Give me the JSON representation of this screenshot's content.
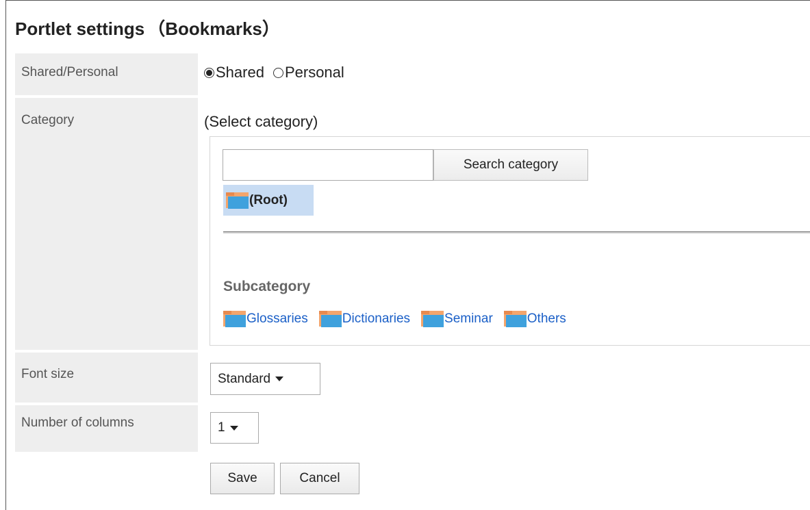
{
  "page": {
    "title": "Portlet settings",
    "title_suffix": "（Bookmarks）"
  },
  "shared_personal": {
    "label": "Shared/Personal",
    "options": [
      {
        "label": "Shared",
        "checked": true
      },
      {
        "label": "Personal",
        "checked": false
      }
    ]
  },
  "category": {
    "label": "Category",
    "selected_text": "(Select category)",
    "search_input_value": "",
    "search_button_label": "Search category",
    "root_label": "(Root)",
    "subcategory_title": "Subcategory",
    "subcategories": [
      "Glossaries",
      "Dictionaries",
      "Seminar",
      "Others"
    ],
    "folder_icon": "folder-icon",
    "colors": {
      "link": "#1a5fc7",
      "root_highlight": "#c8dcf3"
    }
  },
  "font_size": {
    "label": "Font size",
    "selected": "Standard"
  },
  "columns": {
    "label": "Number of columns",
    "selected": "1"
  },
  "actions": {
    "save_label": "Save",
    "cancel_label": "Cancel"
  }
}
